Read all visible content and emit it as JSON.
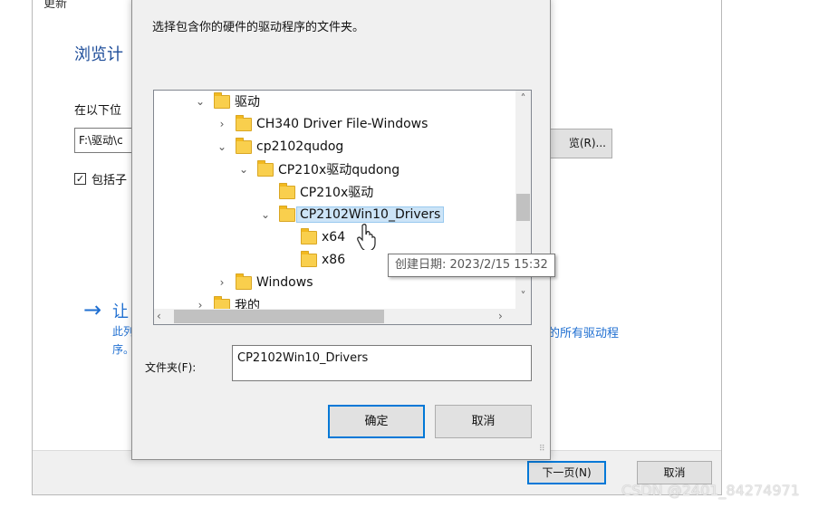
{
  "background_window": {
    "title_fragment": "更新",
    "heading": "浏览计",
    "search_label": "在以下位",
    "path_value": "F:\\驱动\\c",
    "browse_label": "览(R)...",
    "include_subfolders_label": "包括子",
    "include_subfolders_checked": true,
    "pick_title": "让",
    "description_line1": "此列",
    "description_line2": "序。",
    "description_right": "的所有驱动程",
    "next_label": "下一页(N)",
    "cancel_label": "取消"
  },
  "dialog": {
    "instruction": "选择包含你的硬件的驱动程序的文件夹。",
    "tree": [
      {
        "label": "驱动",
        "expanded": true
      },
      {
        "label": "CH340 Driver File-Windows",
        "expanded": false
      },
      {
        "label": "cp2102qudog",
        "expanded": true
      },
      {
        "label": "CP210x驱动qudong",
        "expanded": true
      },
      {
        "label": "CP210x驱动",
        "expanded": null
      },
      {
        "label": "CP2102Win10_Drivers",
        "expanded": true,
        "selected": true
      },
      {
        "label": "x64",
        "expanded": null
      },
      {
        "label": "x86",
        "expanded": null
      },
      {
        "label": "Windows",
        "expanded": false
      },
      {
        "label": "我的",
        "expanded": false
      }
    ],
    "tooltip": "创建日期: 2023/2/15 15:32",
    "folder_label": "文件夹(F):",
    "folder_value": "CP2102Win10_Drivers",
    "ok_label": "确定",
    "cancel_label": "取消"
  },
  "watermark": "CSDN @2401_84274971",
  "colors": {
    "accent": "#0078d7",
    "link_blue": "#1f6fd1",
    "selection": "#cce4f7",
    "folder": "#f9cf4d"
  }
}
